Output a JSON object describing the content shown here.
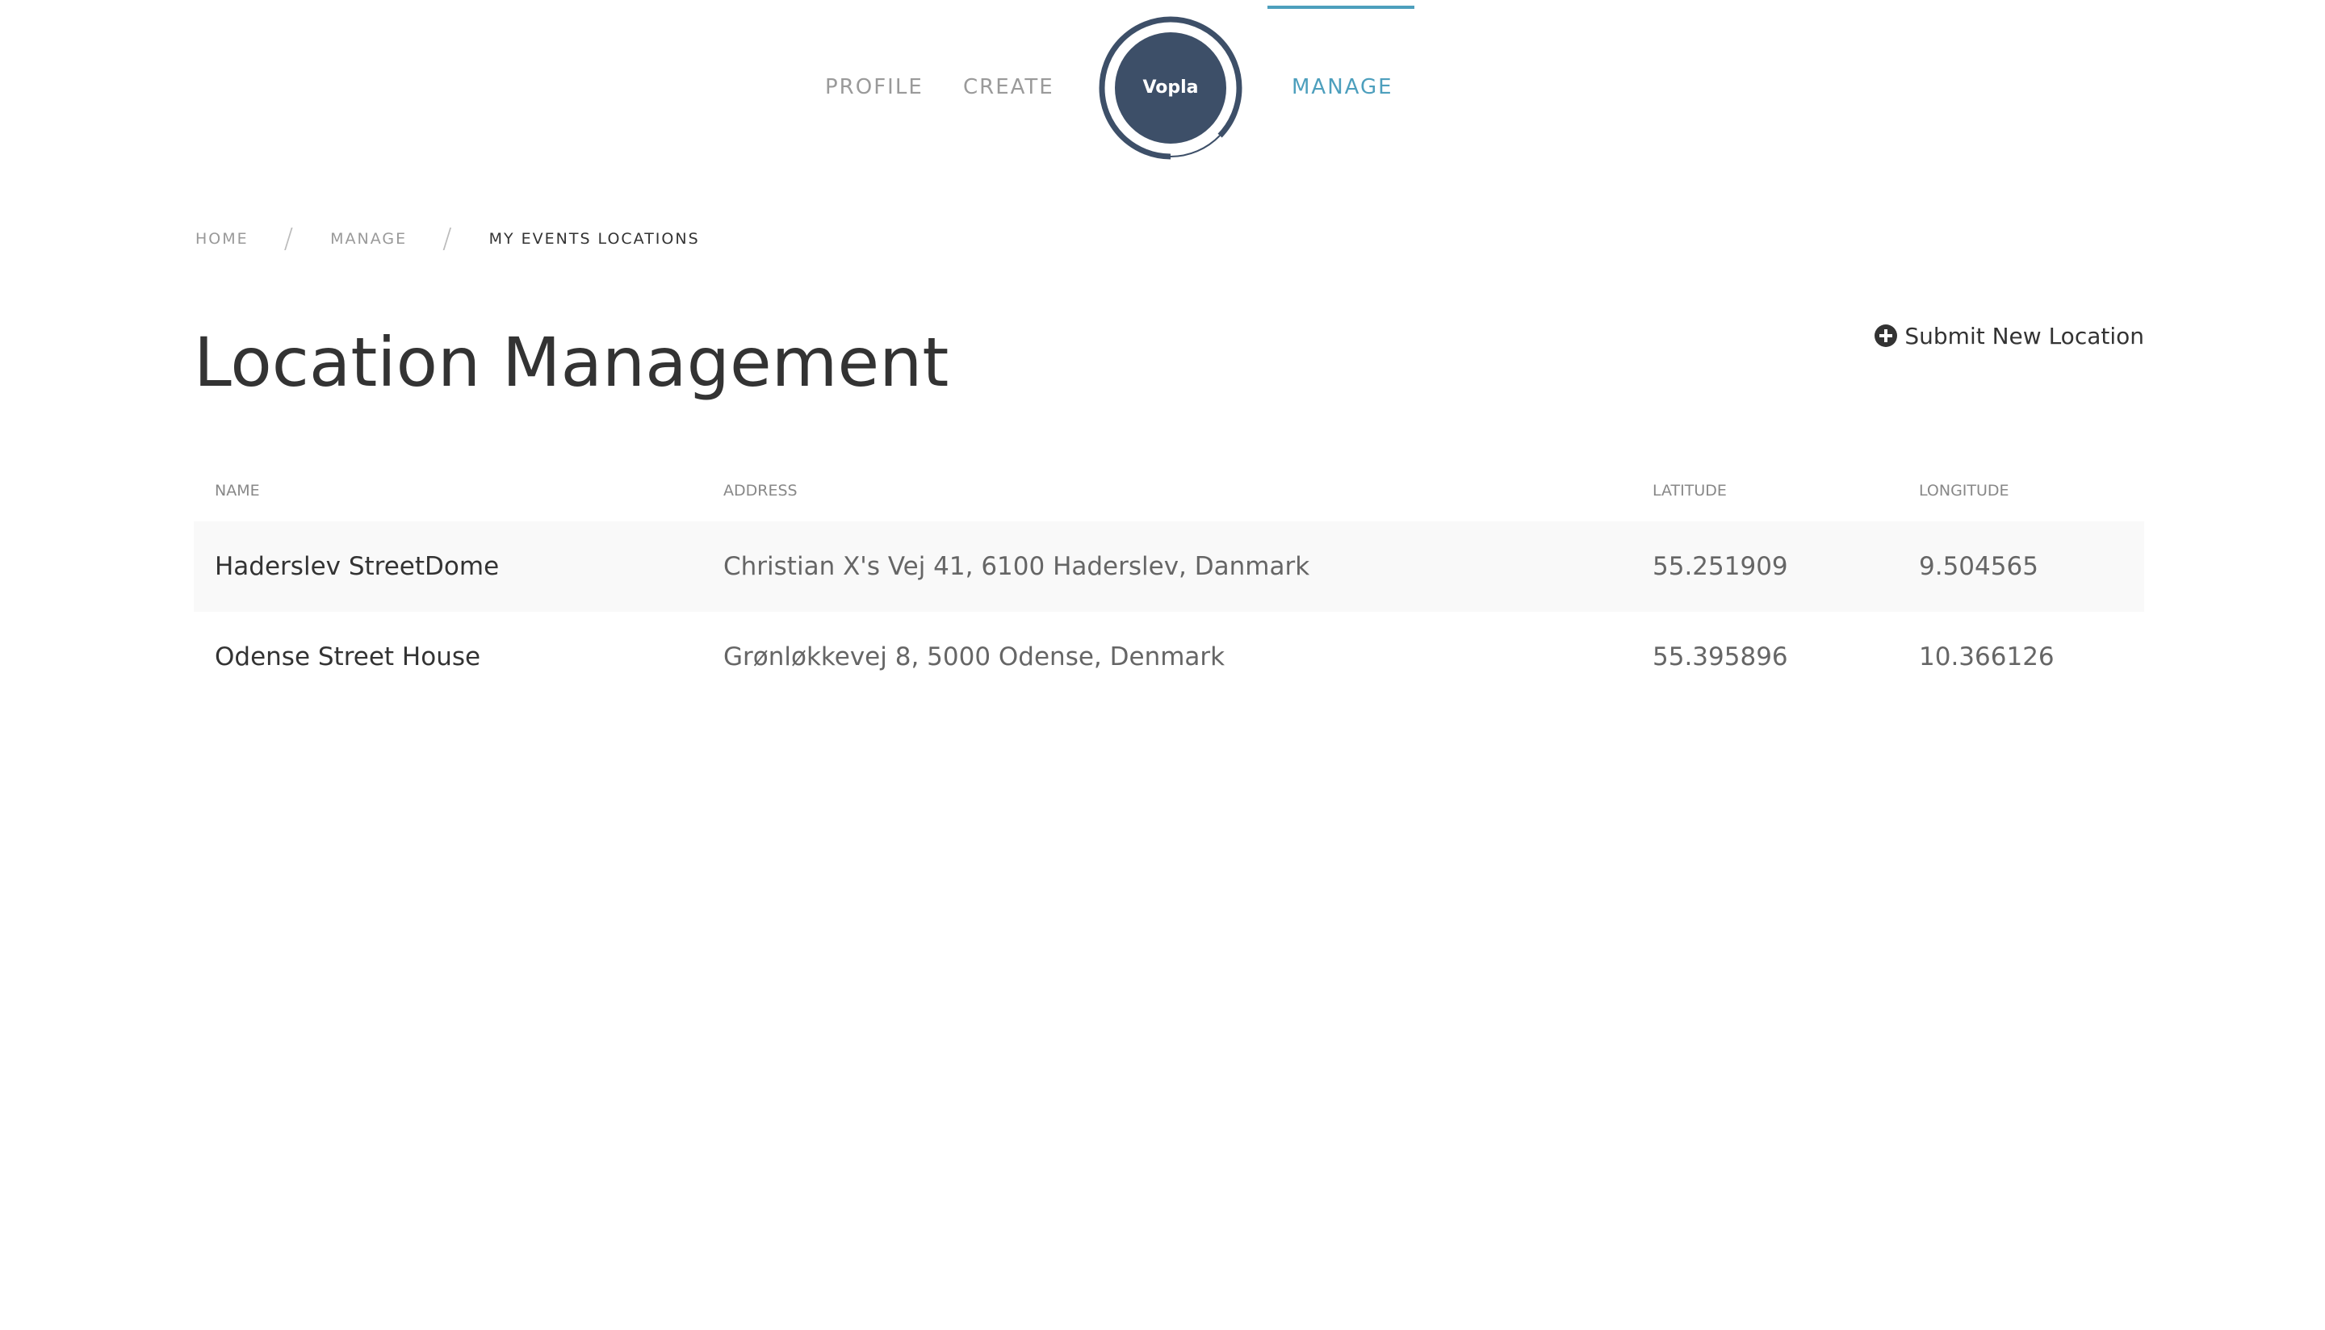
{
  "nav": {
    "profile_label": "PROFILE",
    "create_label": "CREATE",
    "manage_label": "MANAGE",
    "logo_text": "Vopla",
    "active_item": "MANAGE",
    "accent_color": "#4d9fbd",
    "logo_color": "#3d4f68"
  },
  "breadcrumb": {
    "items": [
      "HOME",
      "MANAGE",
      "MY EVENTS LOCATIONS"
    ],
    "separator": "/"
  },
  "page": {
    "title": "Location Management",
    "submit_label": "Submit New Location",
    "submit_icon": "plus-circle-icon"
  },
  "table": {
    "columns": [
      "NAME",
      "ADDRESS",
      "LATITUDE",
      "LONGITUDE"
    ],
    "rows": [
      {
        "name": "Haderslev StreetDome",
        "address": "Christian X's Vej 41, 6100 Haderslev, Danmark",
        "latitude": "55.251909",
        "longitude": "9.504565"
      },
      {
        "name": "Odense Street House",
        "address": "Grønløkkevej 8, 5000 Odense, Denmark",
        "latitude": "55.395896",
        "longitude": "10.366126"
      }
    ]
  }
}
